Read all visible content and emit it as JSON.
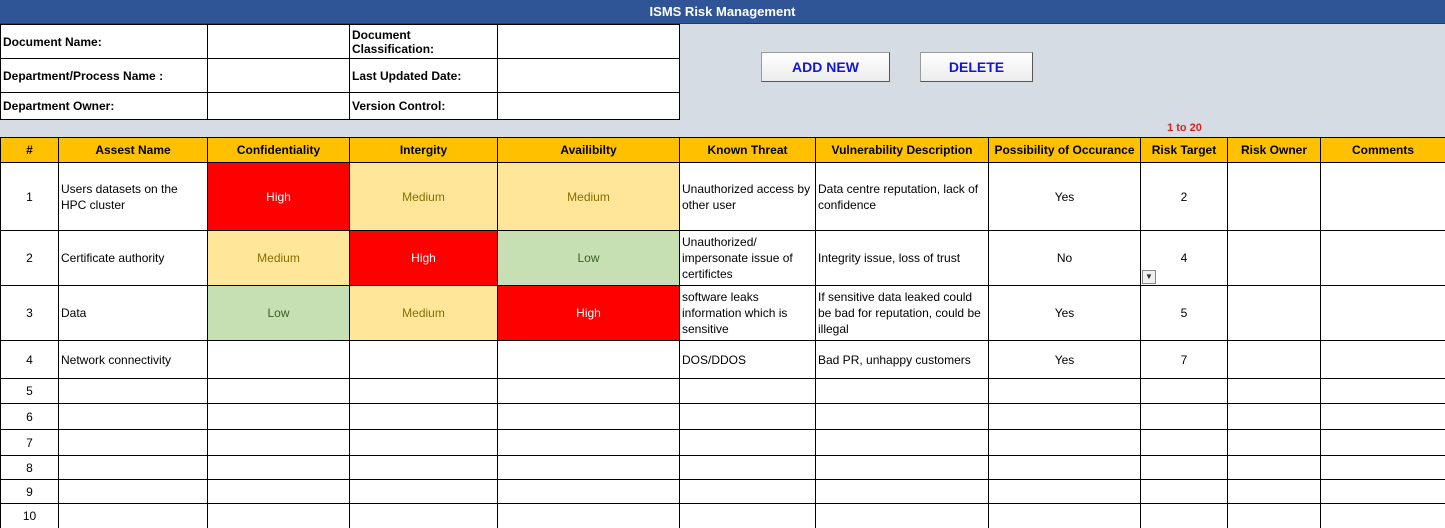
{
  "title": "ISMS Risk Management",
  "info": {
    "doc_name_label": "Document Name:",
    "doc_class_label": "Document Classification:",
    "dept_label": "Department/Process Name :",
    "updated_label": "Last Updated Date:",
    "owner_label": "Department Owner:",
    "version_label": "Version Control:",
    "doc_name_value": "",
    "doc_class_value": "",
    "dept_value": "",
    "updated_value": "",
    "owner_value": "",
    "version_value": ""
  },
  "buttons": {
    "add_new": "ADD NEW",
    "delete": "DELETE"
  },
  "risk_target_range": "1 to 20",
  "headers": [
    "#",
    "Assest Name",
    "Confidentiality",
    "Intergity",
    "Availibilty",
    "Known Threat",
    "Vulnerability Description",
    "Possibility of Occurance",
    "Risk Target",
    "Risk Owner",
    "Comments"
  ],
  "rows": [
    {
      "num": "1",
      "asset": "Users datasets on the HPC cluster",
      "conf": "High",
      "integ": "Medium",
      "avail": "Medium",
      "threat": "Unauthorized access by other user",
      "vuln": "Data centre reputation, lack of confidence",
      "poss": "Yes",
      "target": "2",
      "owner": "",
      "comments": ""
    },
    {
      "num": "2",
      "asset": "Certificate authority",
      "conf": "Medium",
      "integ": "High",
      "avail": "Low",
      "threat": "Unauthorized/ impersonate issue of certifictes",
      "vuln": "Integrity issue, loss of trust",
      "poss": "No",
      "target": "4",
      "owner": "",
      "comments": ""
    },
    {
      "num": "3",
      "asset": "Data",
      "conf": "Low",
      "integ": "Medium",
      "avail": "High",
      "threat": "software leaks information which is sensitive",
      "vuln": "If sensitive data leaked could be bad for reputation, could be illegal",
      "poss": "Yes",
      "target": "5",
      "owner": "",
      "comments": ""
    },
    {
      "num": "4",
      "asset": "Network connectivity",
      "conf": "",
      "integ": "",
      "avail": "",
      "threat": "DOS/DDOS",
      "vuln": "Bad PR, unhappy customers",
      "poss": "Yes",
      "target": "7",
      "owner": "",
      "comments": ""
    },
    {
      "num": "5"
    },
    {
      "num": "6"
    },
    {
      "num": "7"
    },
    {
      "num": "8"
    },
    {
      "num": "9"
    },
    {
      "num": "10"
    }
  ],
  "icons": {
    "dropdown": "dropdown-arrow-icon"
  }
}
